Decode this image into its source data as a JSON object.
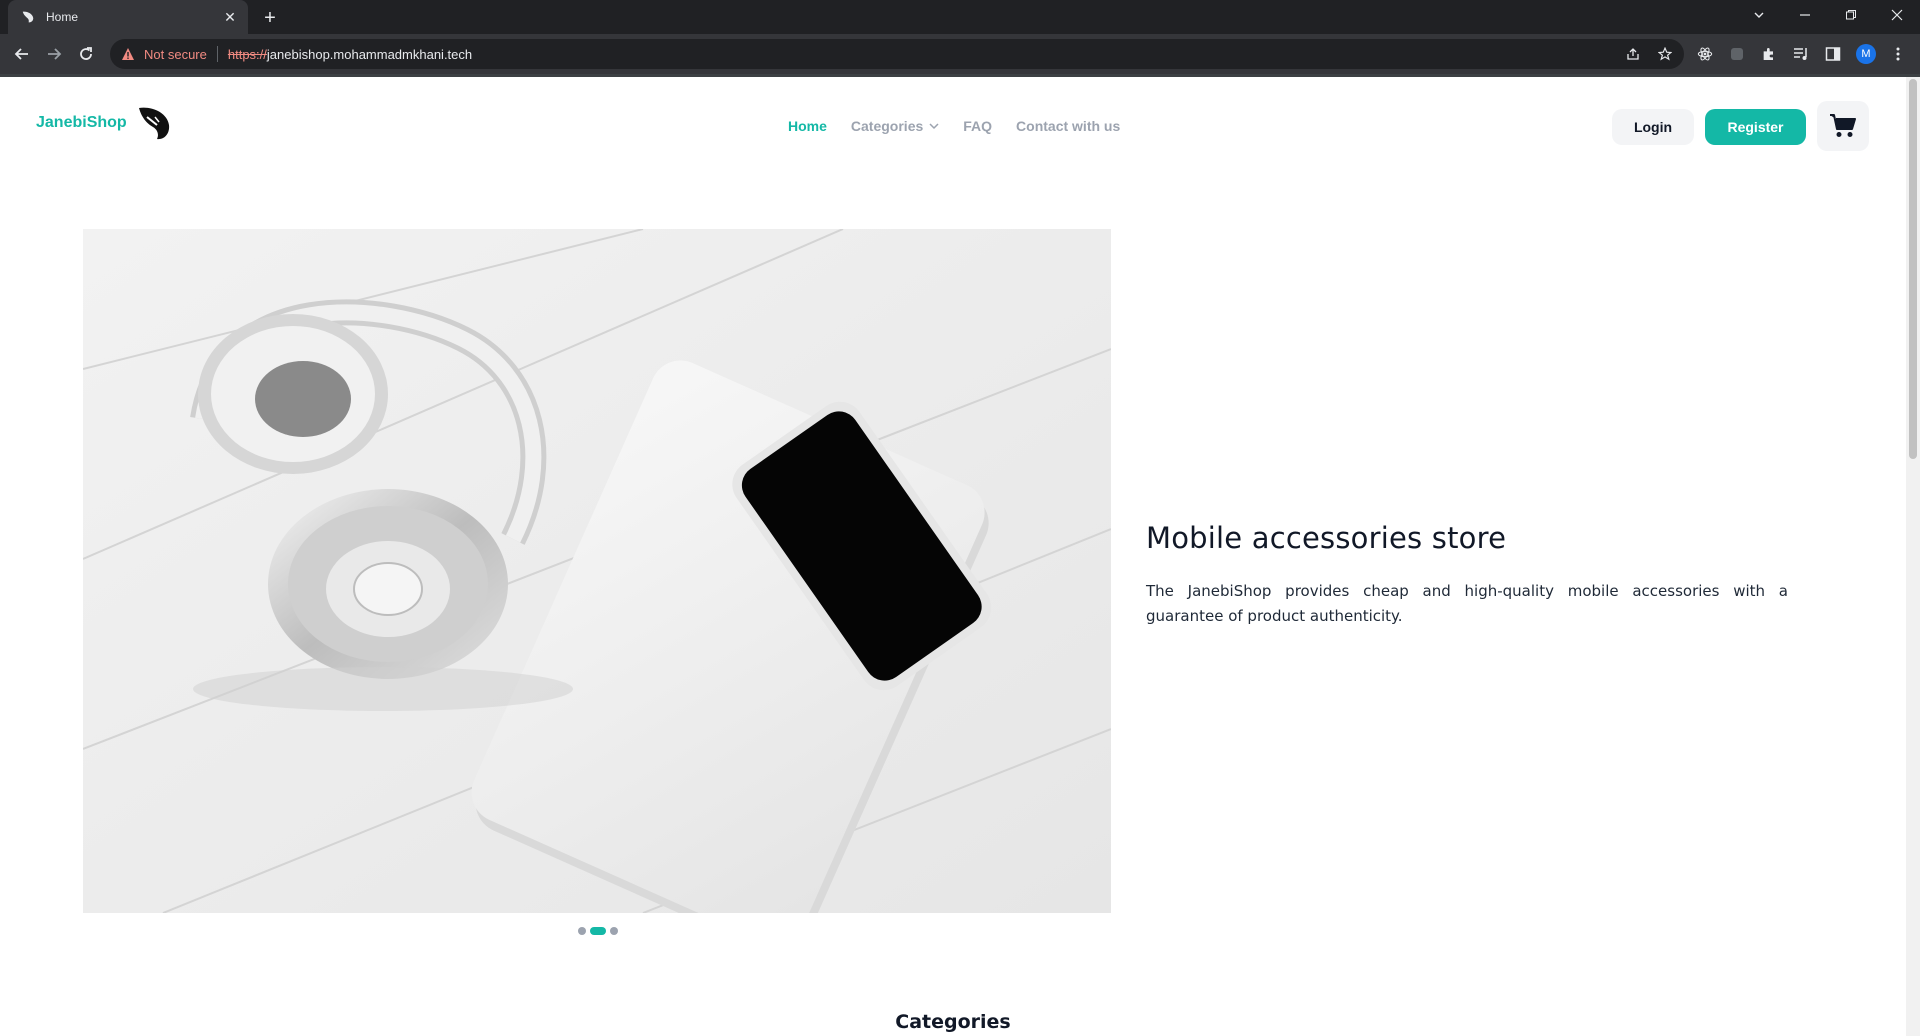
{
  "browser": {
    "tab_title": "Home",
    "new_tab_glyph": "+",
    "close_glyph": "✕",
    "security_label": "Not secure",
    "url_scheme": "https://",
    "url_host": "janebishop.mohammadmkhani.tech",
    "profile_initial": "M",
    "icons": [
      "back-icon",
      "forward-icon",
      "reload-icon",
      "share-icon",
      "bookmark-star-icon",
      "extension-icon",
      "puzzle-icon",
      "media-icon",
      "sidepanel-icon",
      "menu-icon"
    ]
  },
  "site": {
    "brand_name": "JanebiShop",
    "nav": {
      "home": "Home",
      "categories": "Categories",
      "faq": "FAQ",
      "contact": "Contact with us"
    },
    "auth": {
      "login": "Login",
      "register": "Register"
    },
    "accent_color": "#14b8a6"
  },
  "hero": {
    "title": "Mobile accessories store",
    "description": "The JanebiShop provides cheap and high-quality mobile accessories with a guarantee of product authenticity.",
    "carousel": {
      "slide_count": 3,
      "active_index": 1
    }
  },
  "sections": {
    "categories_title": "Categories"
  }
}
